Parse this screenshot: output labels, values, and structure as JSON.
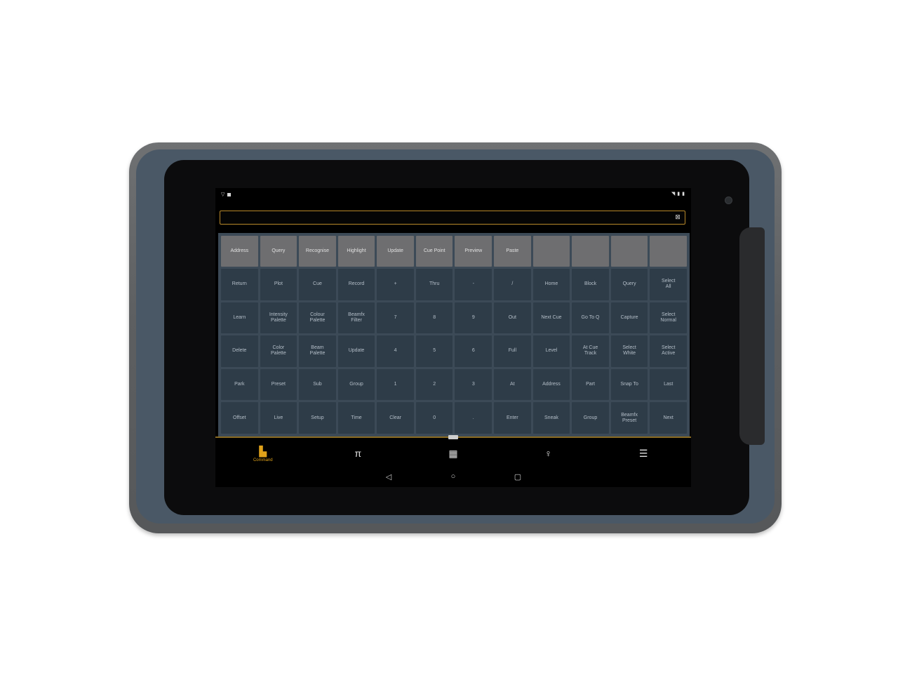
{
  "statusbar": {
    "left_text": "",
    "left_sub": "",
    "right_text": "",
    "right_sub": ""
  },
  "command_line": {
    "text": "",
    "clear_icon": "close-icon"
  },
  "keypad": {
    "top_row": [
      "Address",
      "Query",
      "Recognise",
      "Highlight",
      "Update",
      "Cue Point",
      "Preview",
      "Paste",
      "",
      "",
      "",
      ""
    ],
    "rows": [
      [
        "Return",
        "Plot",
        "Cue",
        "Record",
        "+",
        "Thru",
        "-",
        "/",
        "Home",
        "Block",
        "Query",
        "Select\nAll"
      ],
      [
        "Learn",
        "Intensity\nPalette",
        "Colour\nPalette",
        "Beamfx\nFilter",
        "7",
        "8",
        "9",
        "Out",
        "Next Cue",
        "Go To Q",
        "Capture",
        "Select\nNormal"
      ],
      [
        "Delete",
        "Color\nPalette",
        "Beam\nPalette",
        "Update",
        "4",
        "5",
        "6",
        "Full",
        "Level",
        "At Cue\nTrack",
        "Select\nWhite",
        "Select\nActive"
      ],
      [
        "Park",
        "Preset",
        "Sub",
        "Group",
        "1",
        "2",
        "3",
        "At",
        "Address",
        "Part",
        "Snap To",
        "Last"
      ],
      [
        "Offset",
        "Live",
        "Setup",
        "Time",
        "Clear",
        "0",
        ".",
        "Enter",
        "Sneak",
        "Group",
        "Beamfx\nPreset",
        "Next"
      ]
    ]
  },
  "navtabs": [
    {
      "label": "Command",
      "icon": "keypad-icon",
      "active": true
    },
    {
      "label": "",
      "icon": "pi-icon",
      "active": false
    },
    {
      "label": "",
      "icon": "grid-icon",
      "active": false
    },
    {
      "label": "",
      "icon": "mic-icon",
      "active": false
    },
    {
      "label": "",
      "icon": "faders-icon",
      "active": false
    }
  ],
  "system_nav": {
    "back_icon": "back-triangle-icon",
    "home_icon": "home-circle-icon",
    "recents_icon": "recents-square-icon"
  },
  "colors": {
    "accent": "#e0a21a",
    "key_bg": "#2e3c48",
    "key_top_bg": "#6e6e70",
    "keypad_bg": "#3c4a57"
  }
}
